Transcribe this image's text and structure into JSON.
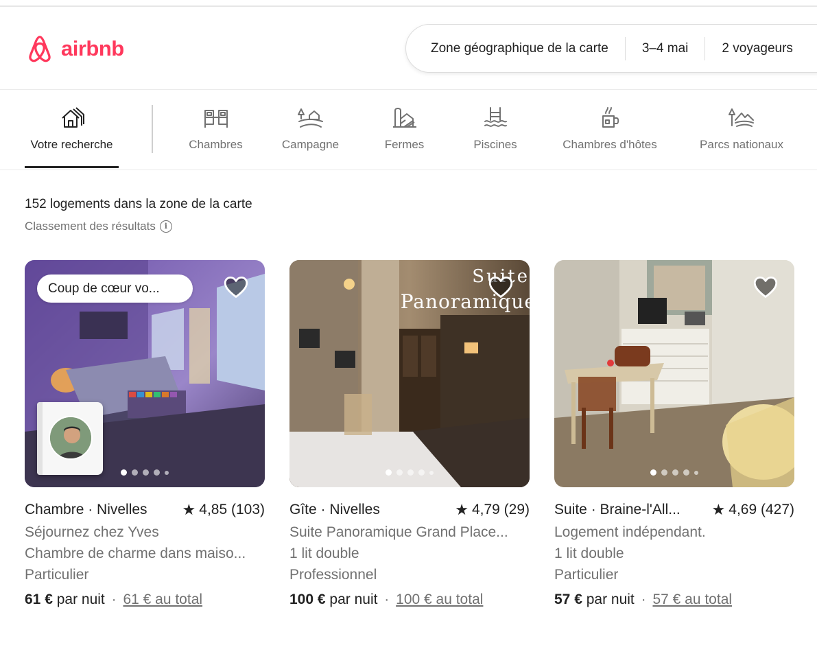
{
  "brand": {
    "name": "airbnb",
    "color": "#ff385c"
  },
  "search": {
    "location": "Zone géographique de la carte",
    "dates": "3–4 mai",
    "guests": "2 voyageurs"
  },
  "categories": [
    {
      "label": "Votre recherche",
      "icon": "house-icon",
      "active": true
    },
    {
      "label": "Chambres",
      "icon": "bed-icon"
    },
    {
      "label": "Campagne",
      "icon": "countryside-icon"
    },
    {
      "label": "Fermes",
      "icon": "farm-icon"
    },
    {
      "label": "Piscines",
      "icon": "pool-icon"
    },
    {
      "label": "Chambres d'hôtes",
      "icon": "mug-icon"
    },
    {
      "label": "Parcs nationaux",
      "icon": "national-park-icon"
    }
  ],
  "results": {
    "count_text": "152 logements dans la zone de la carte",
    "sort_label": "Classement des résultats"
  },
  "listings": [
    {
      "badge": "Coup de cœur vo...",
      "title": "Chambre · Nivelles",
      "rating": "4,85 (103)",
      "line1": "Séjournez chez Yves",
      "line2": "Chambre de charme dans maiso...",
      "line3": "Particulier",
      "price": "61 €",
      "per_night": "par nuit",
      "total": "61 € au total"
    },
    {
      "title": "Gîte · Nivelles",
      "rating": "4,79 (29)",
      "photo_text_top": "Suite",
      "photo_text_bottom": "Panoramique",
      "line1": "Suite Panoramique Grand Place...",
      "line2": "1 lit double",
      "line3": "Professionnel",
      "price": "100 €",
      "per_night": "par nuit",
      "total": "100 € au total"
    },
    {
      "title": "Suite · Braine-l'All...",
      "rating": "4,69 (427)",
      "line1": "Logement indépendant.",
      "line2": "1 lit double",
      "line3": "Particulier",
      "price": "57 €",
      "per_night": "par nuit",
      "total": "57 € au total"
    }
  ],
  "separator": "·"
}
